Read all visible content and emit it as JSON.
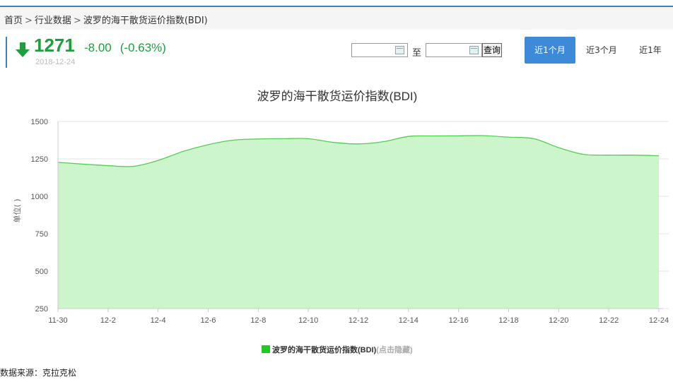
{
  "breadcrumb": {
    "items": [
      "首页",
      "行业数据",
      "波罗的海干散货运价指数(BDI)"
    ],
    "separator": ">"
  },
  "quote": {
    "value": "1271",
    "change": "-8.00",
    "change_pct": "(-0.63%)",
    "date": "2018-12-24",
    "trend": "down",
    "color": "#1e9e3c"
  },
  "date_filter": {
    "from_value": "",
    "to_label": "至",
    "to_value": "",
    "query_label": "查询"
  },
  "range_tabs": [
    {
      "label": "近1个月",
      "active": true
    },
    {
      "label": "近3个月",
      "active": false
    },
    {
      "label": "近1年",
      "active": false
    }
  ],
  "chart_data": {
    "type": "area",
    "title": "波罗的海干散货运价指数(BDI)",
    "ylabel": "单位( )",
    "xlabel": "",
    "ylim": [
      250,
      1500
    ],
    "yticks": [
      250,
      500,
      750,
      1000,
      1250,
      1500
    ],
    "x": [
      "11-30",
      "12-1",
      "12-2",
      "12-3",
      "12-4",
      "12-5",
      "12-6",
      "12-7",
      "12-8",
      "12-9",
      "12-10",
      "12-11",
      "12-12",
      "12-13",
      "12-14",
      "12-15",
      "12-16",
      "12-17",
      "12-18",
      "12-19",
      "12-20",
      "12-21",
      "12-22",
      "12-23",
      "12-24"
    ],
    "x_tick_labels": [
      "11-30",
      "12-2",
      "12-4",
      "12-6",
      "12-8",
      "12-10",
      "12-12",
      "12-14",
      "12-16",
      "12-18",
      "12-20",
      "12-22",
      "12-24"
    ],
    "series": [
      {
        "name": "波罗的海干散货运价指数(BDI)",
        "values": [
          1227,
          1215,
          1205,
          1200,
          1240,
          1300,
          1345,
          1375,
          1383,
          1385,
          1385,
          1360,
          1350,
          1365,
          1400,
          1403,
          1404,
          1405,
          1395,
          1385,
          1325,
          1280,
          1275,
          1275,
          1271
        ]
      }
    ],
    "grid": true,
    "legend_position": "bottom-center",
    "line_color": "#55cc55",
    "fill_color": "#ccf5cc"
  },
  "legend": {
    "label": "波罗的海干散货运价指数(BDI)",
    "hint": "(点击隐藏)"
  },
  "footer": {
    "source": "数据来源：克拉克松"
  }
}
